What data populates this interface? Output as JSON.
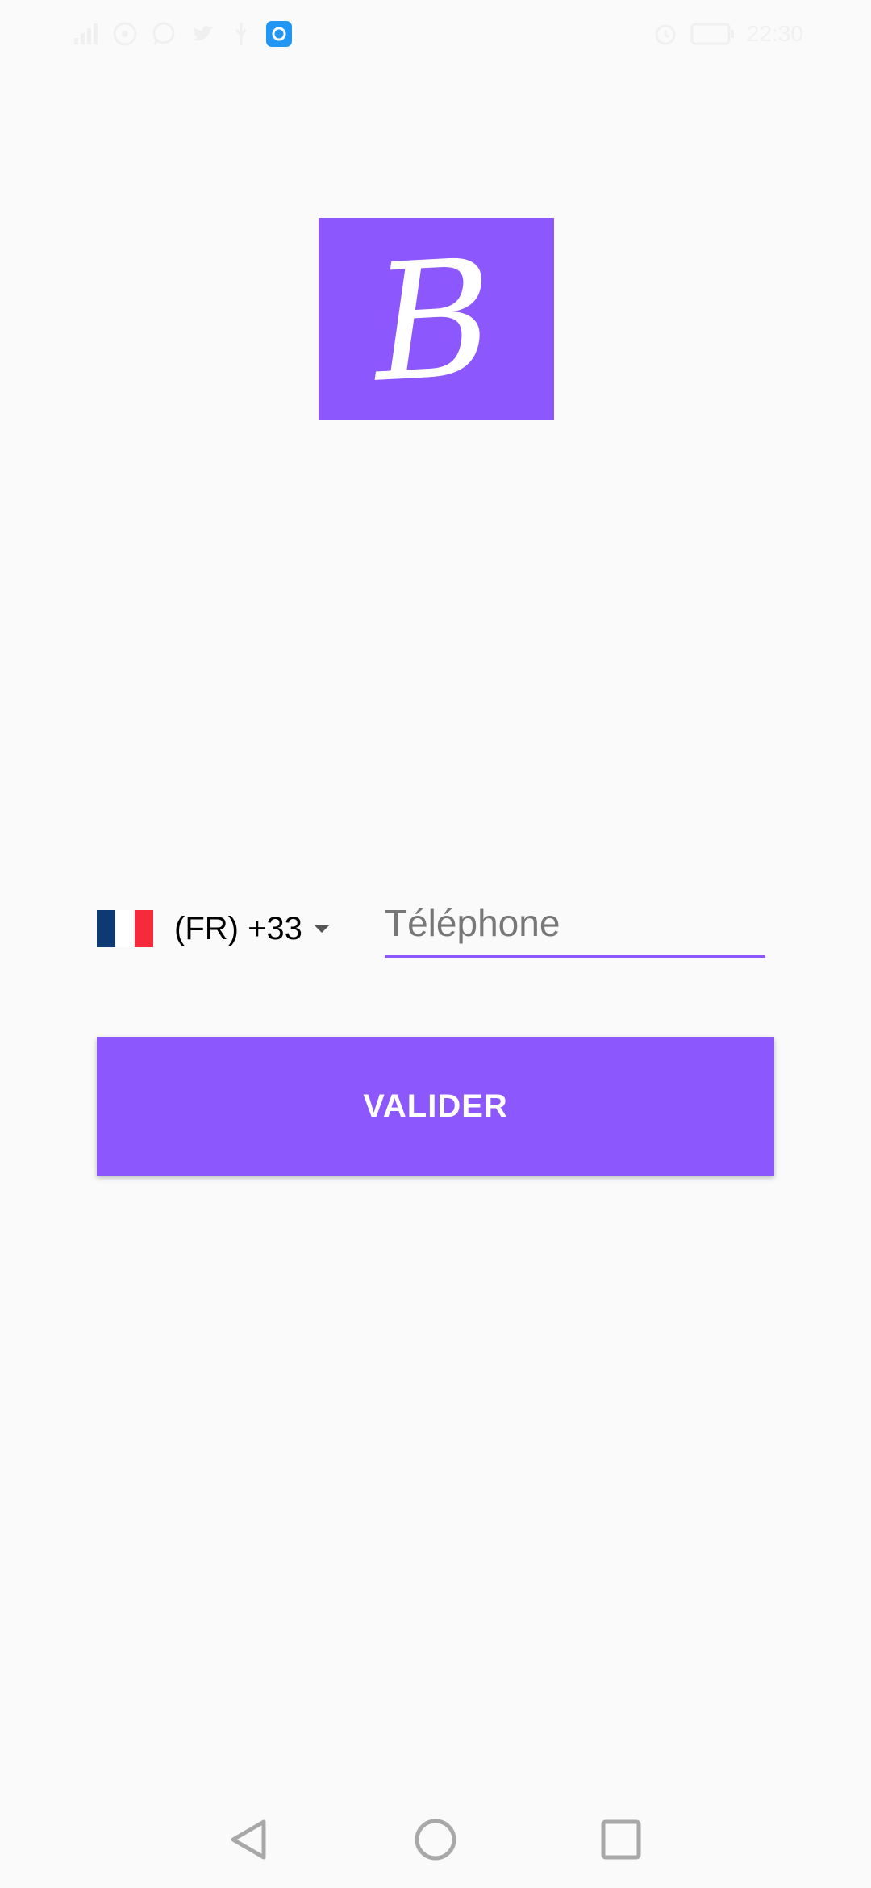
{
  "status_bar": {
    "time": "22:30",
    "battery_level": "100",
    "icons": [
      "signal-icon",
      "hotspot-icon",
      "whatsapp-icon",
      "twitter-icon",
      "usb-icon",
      "app-notification-icon",
      "alarm-icon",
      "battery-icon"
    ]
  },
  "logo": {
    "letter": "B",
    "color": "#8c57fd"
  },
  "country_picker": {
    "flag": "france-flag",
    "code_label": "(FR) +33"
  },
  "phone_input": {
    "placeholder": "Téléphone",
    "value": ""
  },
  "submit_button": {
    "label": "VALIDER",
    "color": "#8c57fd"
  },
  "nav_bar": {
    "icons": [
      "back-icon",
      "home-icon",
      "recents-icon"
    ]
  }
}
